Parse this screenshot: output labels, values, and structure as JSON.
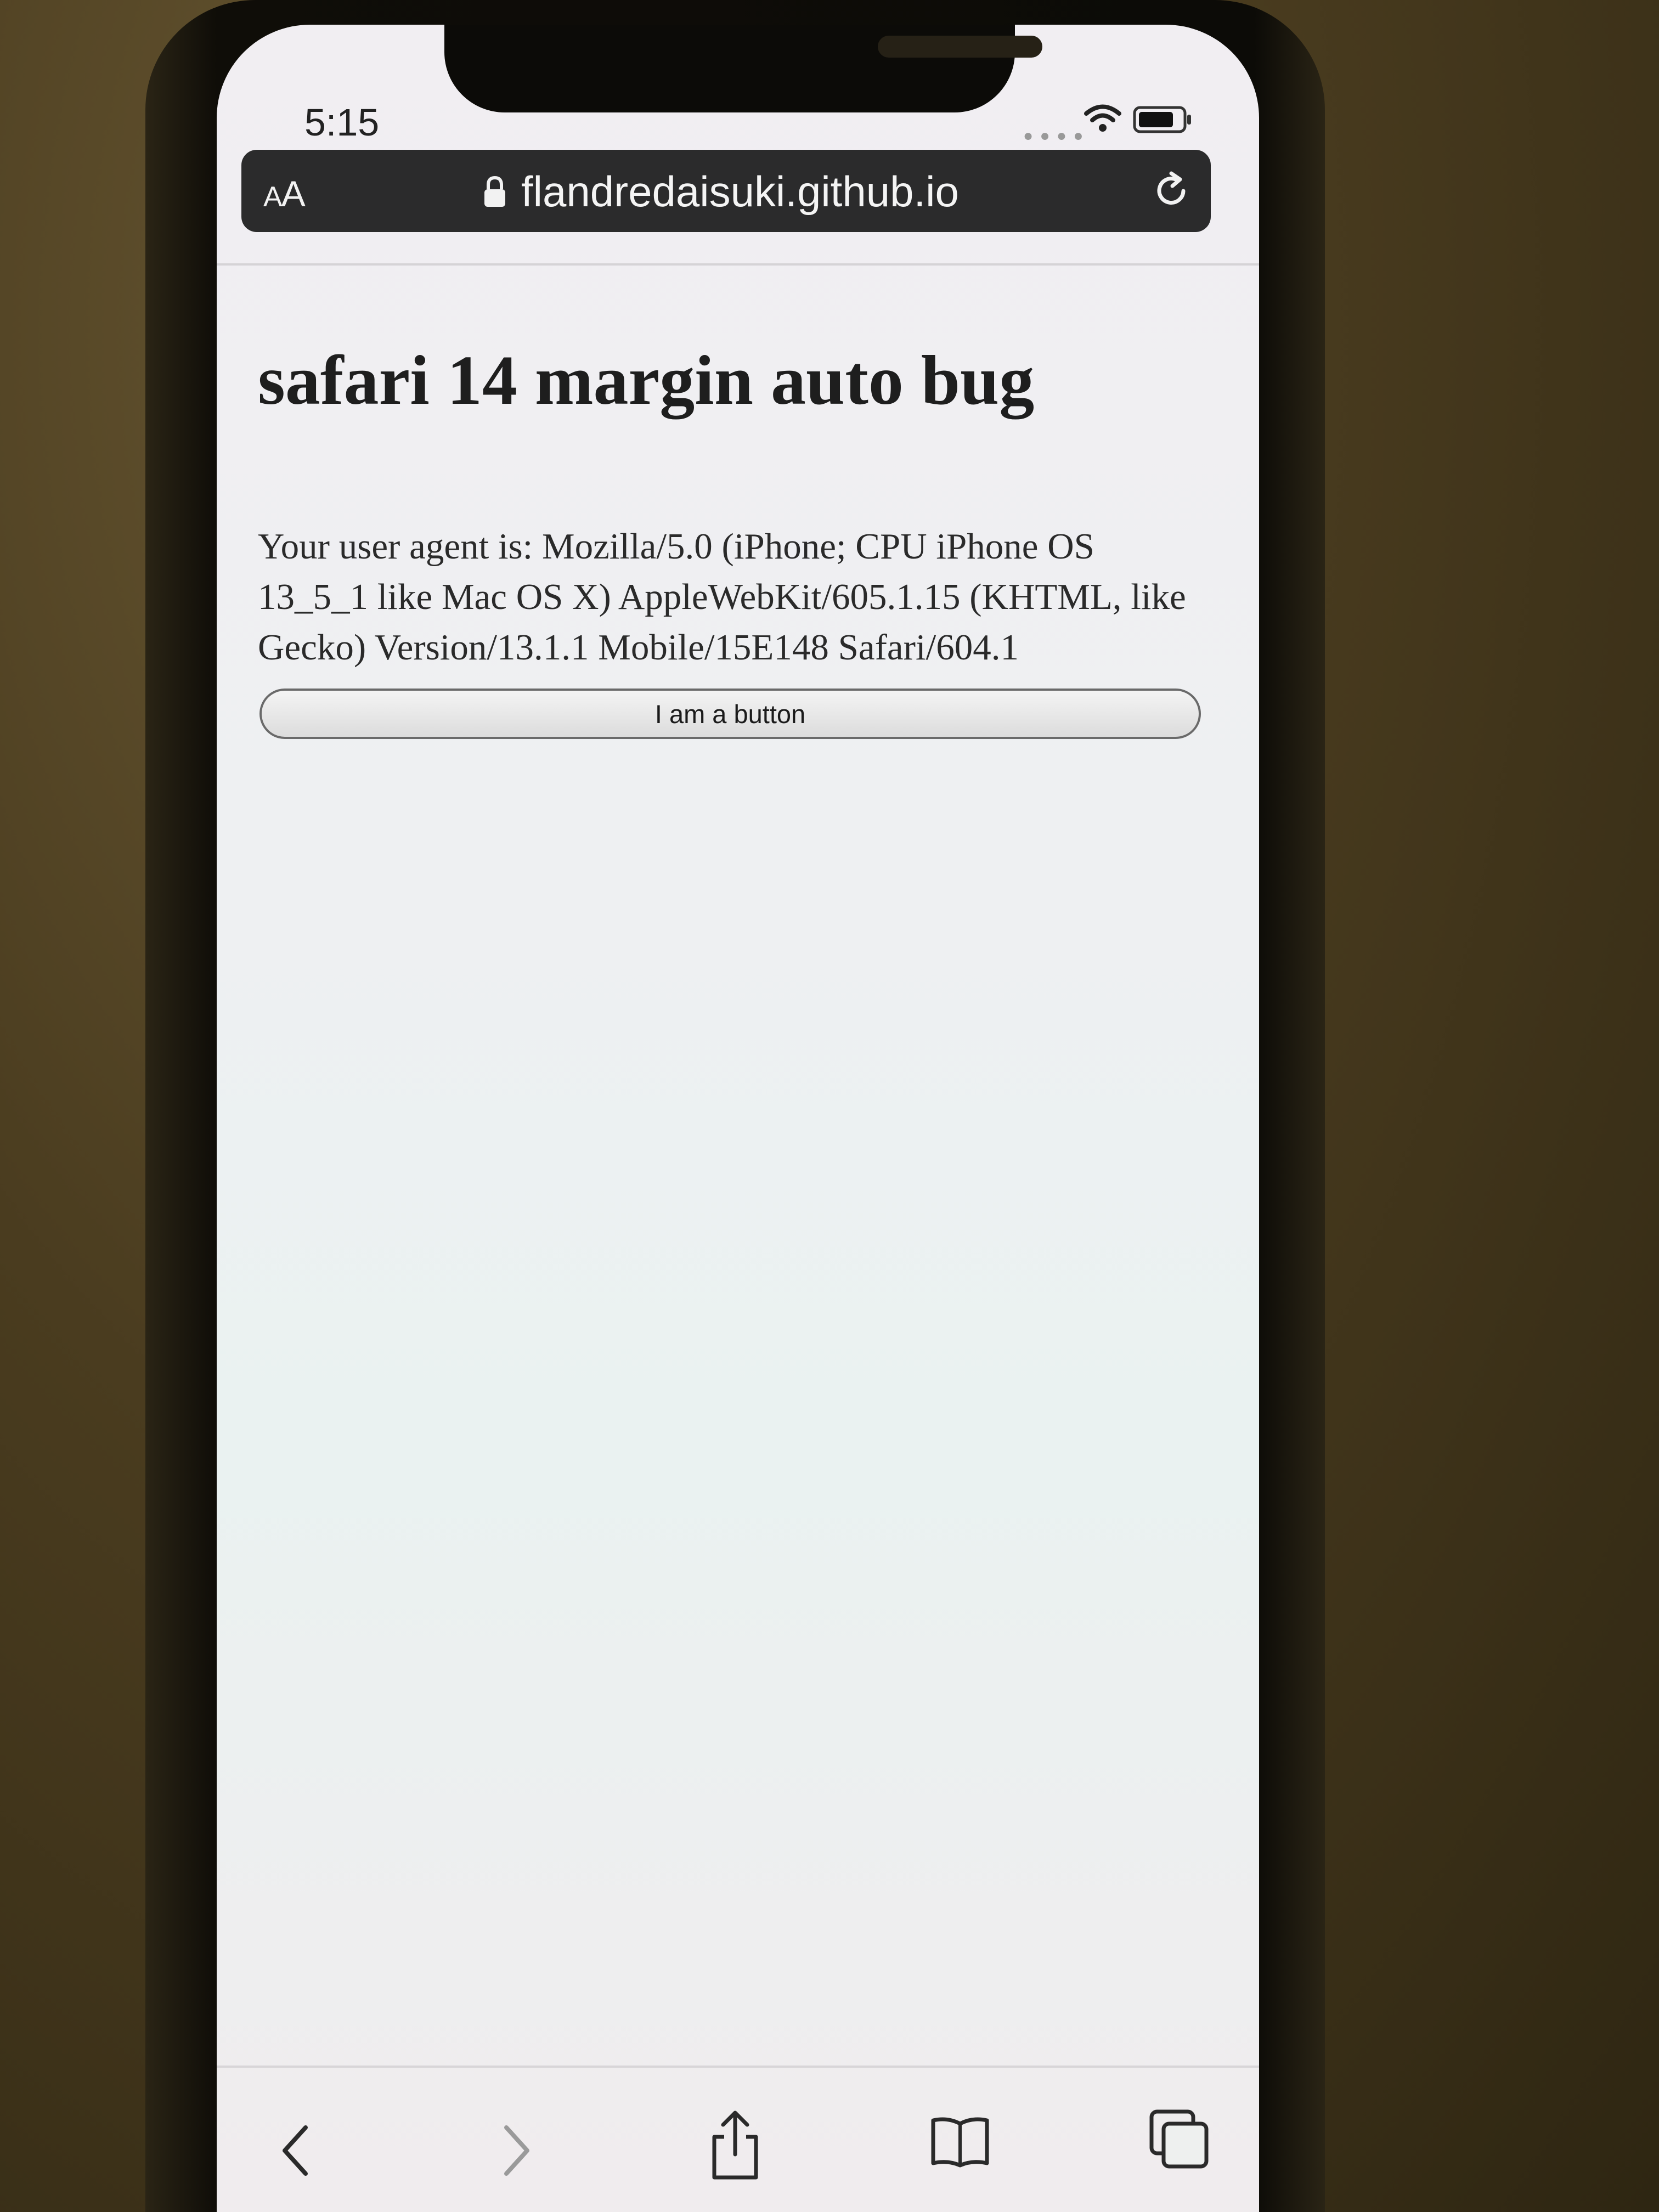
{
  "status_bar": {
    "time": "5:15",
    "signal_icon": "cellular-signal-icon",
    "wifi_icon": "wifi-icon",
    "battery_icon": "battery-icon"
  },
  "url_bar": {
    "text_size_label_small": "A",
    "text_size_label_large": "A",
    "url": "flandredaisuki.github.io",
    "lock_icon": "lock-icon",
    "reload_icon": "reload-icon"
  },
  "page": {
    "heading": "safari 14 margin auto bug",
    "user_agent_text": "Your user agent is: Mozilla/5.0 (iPhone; CPU iPhone OS 13_5_1 like Mac OS X) AppleWebKit/605.1.15 (KHTML, like Gecko) Version/13.1.1 Mobile/15E148 Safari/604.1",
    "button_label": "I am a button"
  },
  "toolbar": {
    "back_icon": "back-chevron-icon",
    "forward_icon": "forward-chevron-icon",
    "share_icon": "share-icon",
    "bookmarks_icon": "bookmarks-book-icon",
    "tabs_icon": "tabs-icon"
  },
  "colors": {
    "url_bar_bg": "#2b2b2c",
    "page_bg": "#eef0f2",
    "text": "#1e1e1e"
  }
}
